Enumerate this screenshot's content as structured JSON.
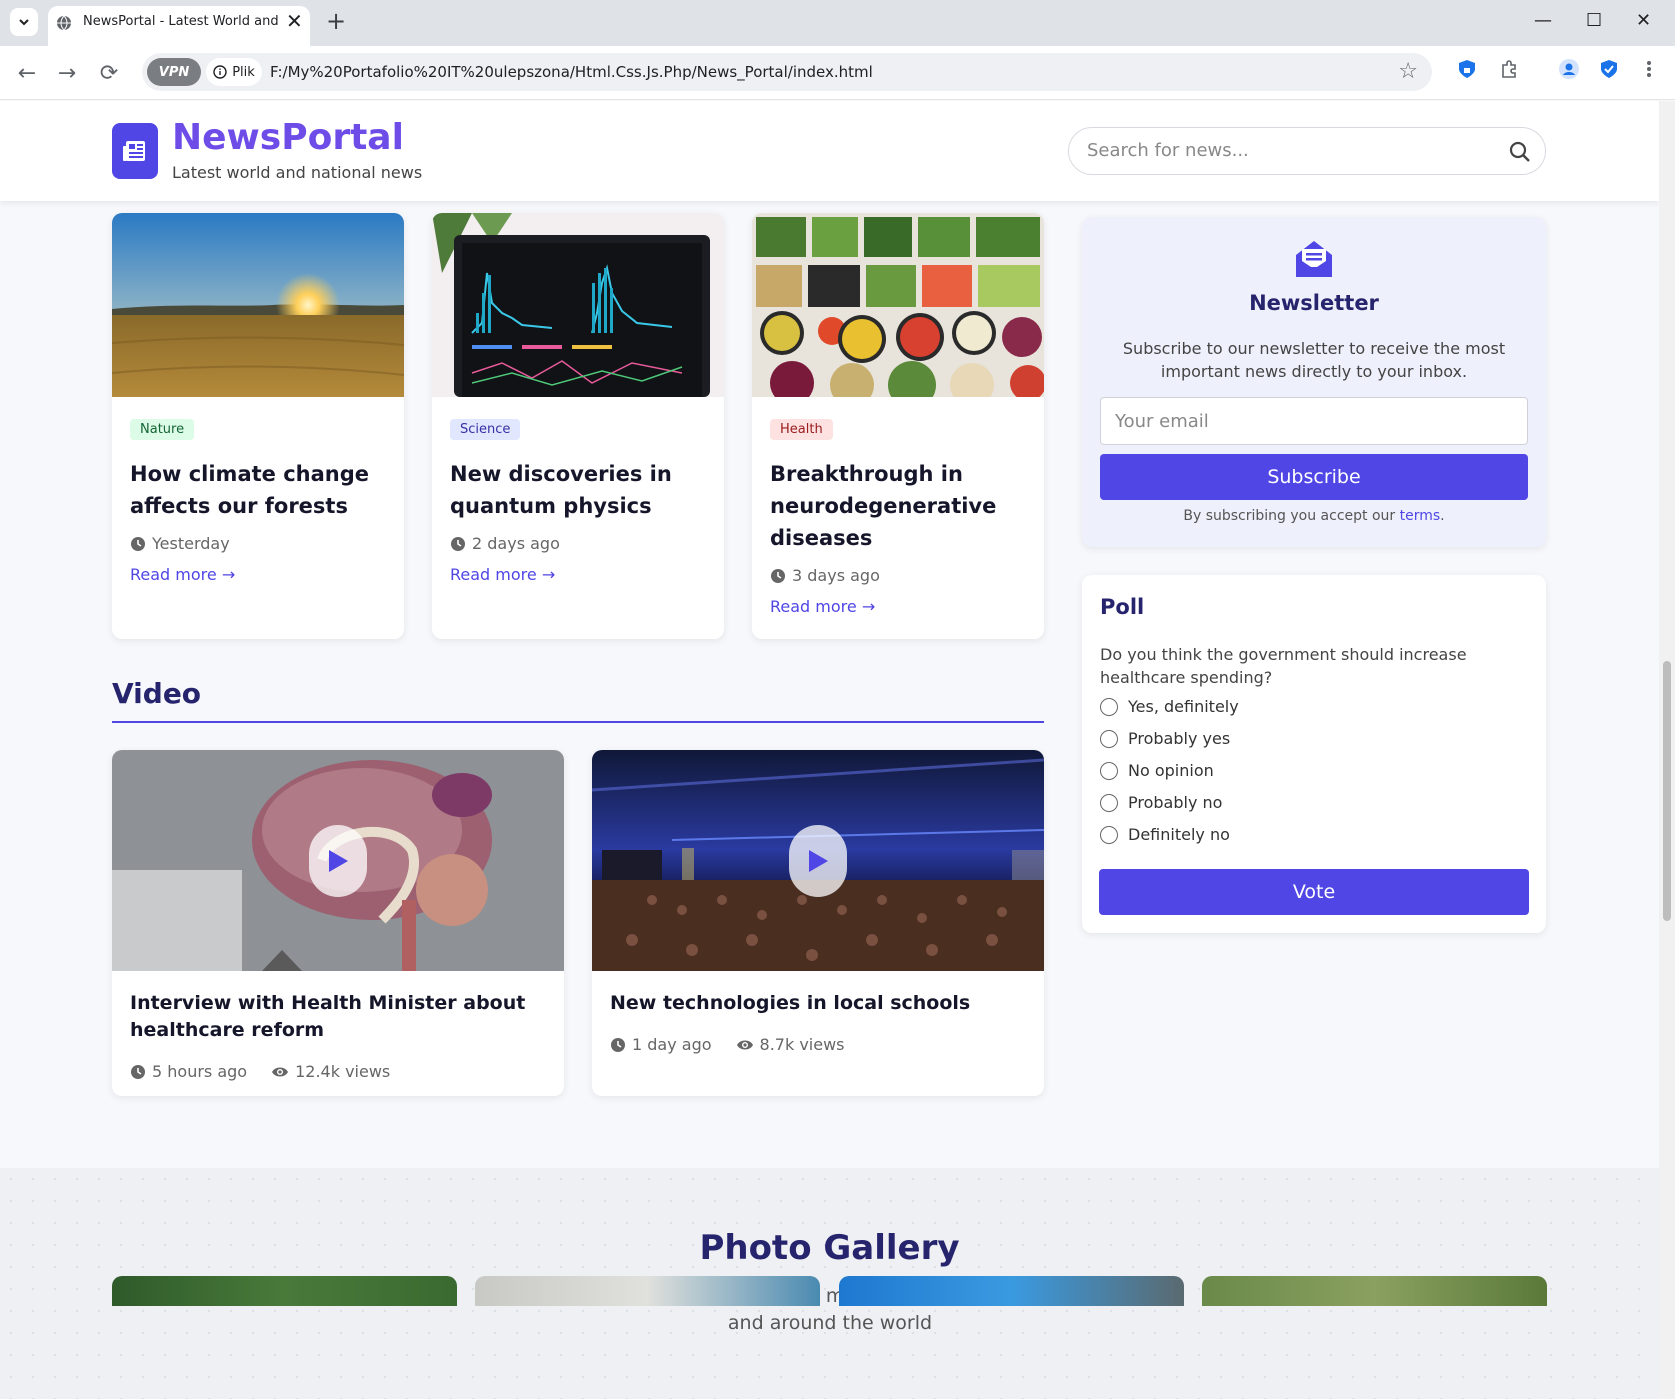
{
  "browser": {
    "tab_title": "NewsPortal - Latest World and National News",
    "vpn_label": "VPN",
    "info_label": "Plik",
    "url": "F:/My%20Portafolio%20IT%20ulepszona/Html.Css.Js.Php/News_Portal/index.html"
  },
  "header": {
    "brand": "NewsPortal",
    "tagline": "Latest world and national news",
    "search_placeholder": "Search for news..."
  },
  "articles": [
    {
      "category": "Nature",
      "title": "How climate change affects our forests",
      "time": "Yesterday",
      "read_more": "Read more →"
    },
    {
      "category": "Science",
      "title": "New discoveries in quantum physics",
      "time": "2 days ago",
      "read_more": "Read more →"
    },
    {
      "category": "Health",
      "title": "Breakthrough in neurodegenerative diseases",
      "time": "3 days ago",
      "read_more": "Read more →"
    }
  ],
  "video_section": {
    "title": "Video",
    "items": [
      {
        "title": "Interview with Health Minister about healthcare reform",
        "time": "5 hours ago",
        "views": "12.4k views"
      },
      {
        "title": "New technologies in local schools",
        "time": "1 day ago",
        "views": "8.7k views"
      }
    ]
  },
  "newsletter": {
    "title": "Newsletter",
    "description": "Subscribe to our newsletter to receive the most important news directly to your inbox.",
    "email_placeholder": "Your email",
    "button": "Subscribe",
    "terms_prefix": "By subscribing you accept our",
    "terms_link": "terms",
    "terms_suffix": "."
  },
  "poll": {
    "title": "Poll",
    "question": "Do you think the government should increase healthcare spending?",
    "options": [
      "Yes, definitely",
      "Probably yes",
      "No opinion",
      "Probably no",
      "Definitely no"
    ],
    "button": "Vote"
  },
  "gallery": {
    "title": "Photo Gallery",
    "subtitle": "See our best photo reports from the most important events in the country and around the world"
  },
  "colors": {
    "accent": "#4f46e5",
    "heading": "#27246e",
    "nature_badge_bg": "#dcfce7",
    "nature_badge_fg": "#166534",
    "science_badge_bg": "#e0e7ff",
    "science_badge_fg": "#3730a3",
    "health_badge_bg": "#fee2e2",
    "health_badge_fg": "#991b1b"
  }
}
